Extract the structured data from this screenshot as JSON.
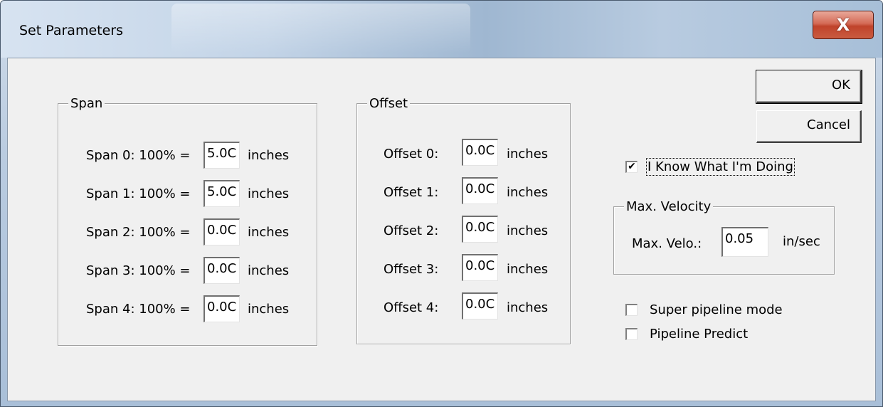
{
  "window": {
    "title": "Set Parameters",
    "close_glyph": "X"
  },
  "buttons": {
    "ok": "OK",
    "cancel": "Cancel"
  },
  "span": {
    "legend": "Span",
    "unit": "inches",
    "rows": [
      {
        "label": "Span 0: 100% =",
        "value": "5.0C"
      },
      {
        "label": "Span 1: 100% =",
        "value": "5.0C"
      },
      {
        "label": "Span 2: 100% =",
        "value": "0.0C"
      },
      {
        "label": "Span 3: 100% =",
        "value": "0.0C"
      },
      {
        "label": "Span 4: 100% =",
        "value": "0.0C"
      }
    ]
  },
  "offset": {
    "legend": "Offset",
    "unit": "inches",
    "rows": [
      {
        "label": "Offset 0:",
        "value": "0.0C"
      },
      {
        "label": "Offset 1:",
        "value": "0.0C"
      },
      {
        "label": "Offset 2:",
        "value": "0.0C"
      },
      {
        "label": "Offset 3:",
        "value": "0.0C"
      },
      {
        "label": "Offset 4:",
        "value": "0.0C"
      }
    ]
  },
  "know_checkbox": {
    "label": "I Know What I'm Doing",
    "checked": true,
    "mark": "✔"
  },
  "velocity": {
    "legend": "Max. Velocity",
    "label": "Max. Velo.:",
    "value": "0.05",
    "unit": "in/sec"
  },
  "options": {
    "super_pipeline": {
      "label": "Super pipeline mode",
      "checked": false
    },
    "pipeline_predict": {
      "label": "Pipeline Predict",
      "checked": false
    }
  },
  "colors": {
    "client_bg": "#f0f0f0",
    "close_red": "#c0432b"
  },
  "icons": {
    "close": "close-icon",
    "check": "checkmark-icon"
  }
}
